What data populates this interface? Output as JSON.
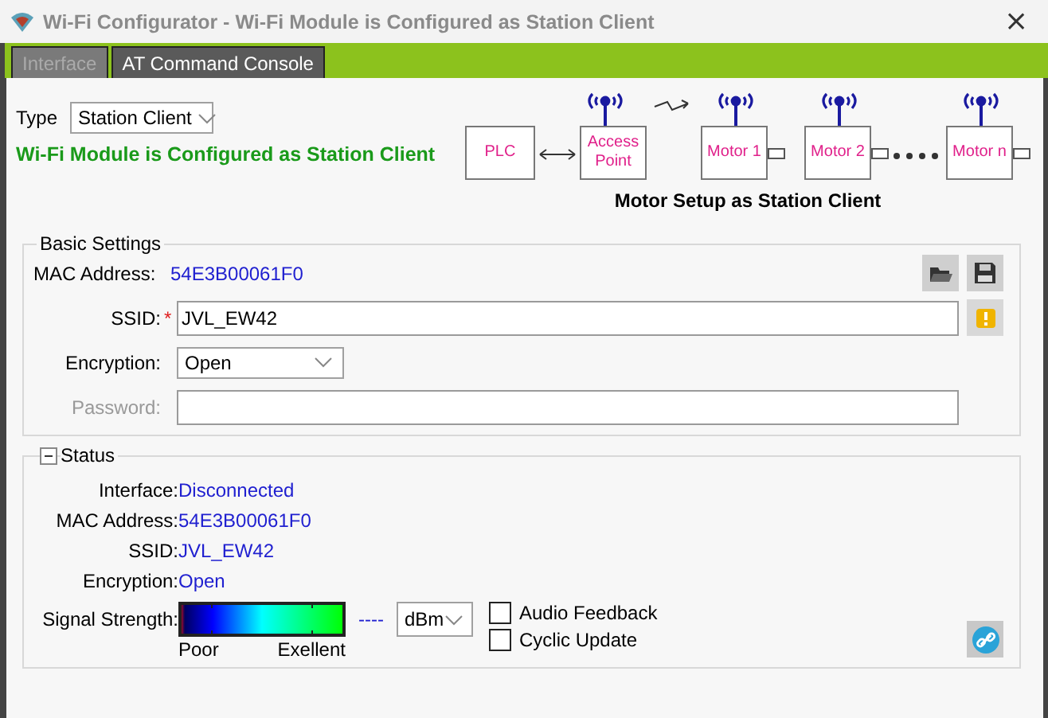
{
  "window": {
    "title": "Wi-Fi Configurator - Wi-Fi Module is Configured as Station Client",
    "close": "×"
  },
  "tabs": [
    {
      "label": "Interface",
      "selected": true
    },
    {
      "label": "AT Command Console",
      "selected": false
    }
  ],
  "type": {
    "label": "Type",
    "value": "Station Client"
  },
  "status_message": "Wi-Fi Module is Configured as Station Client",
  "diagram": {
    "caption": "Motor Setup as Station Client",
    "nodes": [
      {
        "label": "PLC",
        "kind": "plain"
      },
      {
        "kind": "double-arrow"
      },
      {
        "label": "Access Point",
        "kind": "antenna"
      },
      {
        "kind": "wireless"
      },
      {
        "label": "Motor 1",
        "kind": "motor"
      },
      {
        "label": "Motor 2",
        "kind": "motor"
      },
      {
        "kind": "dots"
      },
      {
        "label": "Motor n",
        "kind": "motor"
      }
    ]
  },
  "basic_settings": {
    "title": "Basic Settings",
    "mac_label": "MAC Address:",
    "mac": "54E3B00061F0",
    "ssid_label": "SSID:",
    "required_mark": "*",
    "ssid": "JVL_EW42",
    "encryption_label": "Encryption:",
    "encryption": "Open",
    "password_label": "Password:",
    "password_disabled": true
  },
  "status": {
    "title": "Status",
    "collapsed": false,
    "rows": [
      {
        "label": "Interface:",
        "value": "Disconnected"
      },
      {
        "label": "MAC Address:",
        "value": "54E3B00061F0"
      },
      {
        "label": "SSID:",
        "value": "JVL_EW42"
      },
      {
        "label": "Encryption:",
        "value": "Open"
      }
    ],
    "signal_label": "Signal Strength:",
    "poor": "Poor",
    "excellent": "Exellent",
    "reading": "----",
    "unit": "dBm",
    "options": [
      {
        "label": "Audio Feedback",
        "checked": false
      },
      {
        "label": "Cyclic Update",
        "checked": false
      }
    ]
  }
}
